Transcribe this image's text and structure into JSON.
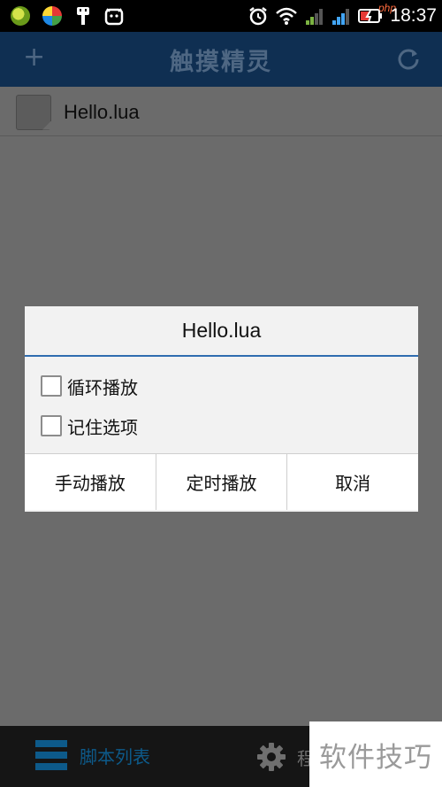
{
  "status_bar": {
    "time": "18:37",
    "badge": "php",
    "icons": [
      "app-icon-green",
      "app-icon-compass",
      "usb-debug-icon",
      "android-icon",
      "alarm-icon",
      "wifi-icon",
      "signal-icon",
      "signal-icon-2",
      "battery-charging-icon"
    ]
  },
  "title_bar": {
    "title": "触摸精灵",
    "add_icon": "plus-icon",
    "refresh_icon": "refresh-icon"
  },
  "script_list": {
    "items": [
      {
        "name": "Hello.lua",
        "icon": "file-icon"
      }
    ]
  },
  "dialog": {
    "title": "Hello.lua",
    "options": [
      {
        "label": "循环播放",
        "checked": false
      },
      {
        "label": "记住选项",
        "checked": false
      }
    ],
    "buttons": {
      "manual": "手动播放",
      "timed": "定时播放",
      "cancel": "取消"
    }
  },
  "bottom_bar": {
    "tab1_label": "脚本列表",
    "tab1_icon": "menu-icon",
    "tab2_label": "程",
    "tab2_icon": "gear-icon"
  },
  "watermark": {
    "text": "软件技巧"
  },
  "colors": {
    "accent": "#2f6db0",
    "title_bar": "#0f2f52",
    "tab_active": "#0d5a8a"
  }
}
